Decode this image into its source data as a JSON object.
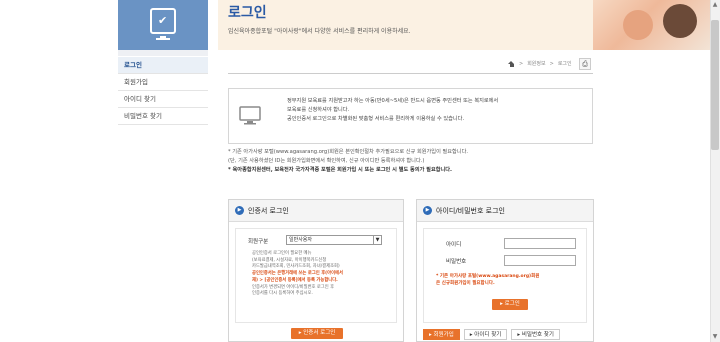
{
  "banner": {
    "title": "로그인",
    "subtitle": "임신육아종합포털 \"아이사랑\"에서 다양한 서비스를 편리하게 이용하세요."
  },
  "sidebar": {
    "items": [
      {
        "label": "로그인",
        "active": true
      },
      {
        "label": "회원가입",
        "active": false
      },
      {
        "label": "아이디 찾기",
        "active": false
      },
      {
        "label": "비밀번호 찾기",
        "active": false
      }
    ]
  },
  "breadcrumb": {
    "items": [
      "회원정보",
      "로그인"
    ]
  },
  "notice": {
    "line1": "정부지원 보육료를 지원받고자 하는 아동(만0세~5세)은 반드시 읍면동 주민센터 또는 복지로에서",
    "line2": "보육료를 신청하셔야 합니다.",
    "line3": "공인인증서 로그인으로 차별화된 맞춤형 서비스를 편리하게 이용하실 수 있습니다."
  },
  "notes": {
    "line1": "* 기존 아가사랑 포털(www.agasarang.org)회원은 본인확인절차 추가필요으로 신규 회원가입이 필요합니다.",
    "line2": "(단, 기존 사용하셨던 ID는 회원가입화면에서 확인하여, 신규 아이디만 등록하셔야 합니다.)",
    "line3": "* 육아종합지원센터, 보육전자 국가자격증 포털은 회원가입 시 또는 로그인 시 별도 동의가 필요합니다."
  },
  "cert_panel": {
    "title": "인증서 로그인",
    "member_label": "회원구분",
    "member_select": "일반사용자",
    "notes": [
      {
        "text": "공인인증서 로그인이 필요한 메뉴",
        "red": false
      },
      {
        "text": "(보육료결제, 시설자료, 아이행복카드신청",
        "red": false
      },
      {
        "text": "카드발급내역조회, 민사카드조회, 자녀/결제조회)",
        "red": false
      },
      {
        "text": "공인인증서는 은행거래에 쓰는 로그인 후(아이에서",
        "red": true
      },
      {
        "text": "재) > [공인인증서 등록]에서 등록 가능합니다.",
        "red": true
      },
      {
        "text": "인증서가 변경되면 아이디/비밀번호 로그인 후",
        "red": false
      },
      {
        "text": "인증서를 다시 등록하여 주십시오.",
        "red": false
      }
    ],
    "button": "인증서 로그인"
  },
  "id_panel": {
    "title": "아이디/비밀번호 로그인",
    "id_label": "아이디",
    "pw_label": "비밀번호",
    "note_line1": "* 기존 아가사랑 포털(www.agasarang.org)회원",
    "note_line2": "은 신규회원가입이 필요합니다.",
    "login_button": "로그인",
    "bottom_buttons": [
      "회원가입",
      "아이디 찾기",
      "비밀번호 찾기"
    ]
  },
  "colors": {
    "accent_blue": "#2f6cb8",
    "orange": "#e8722b",
    "banner_bg": "#fbf1e3"
  }
}
